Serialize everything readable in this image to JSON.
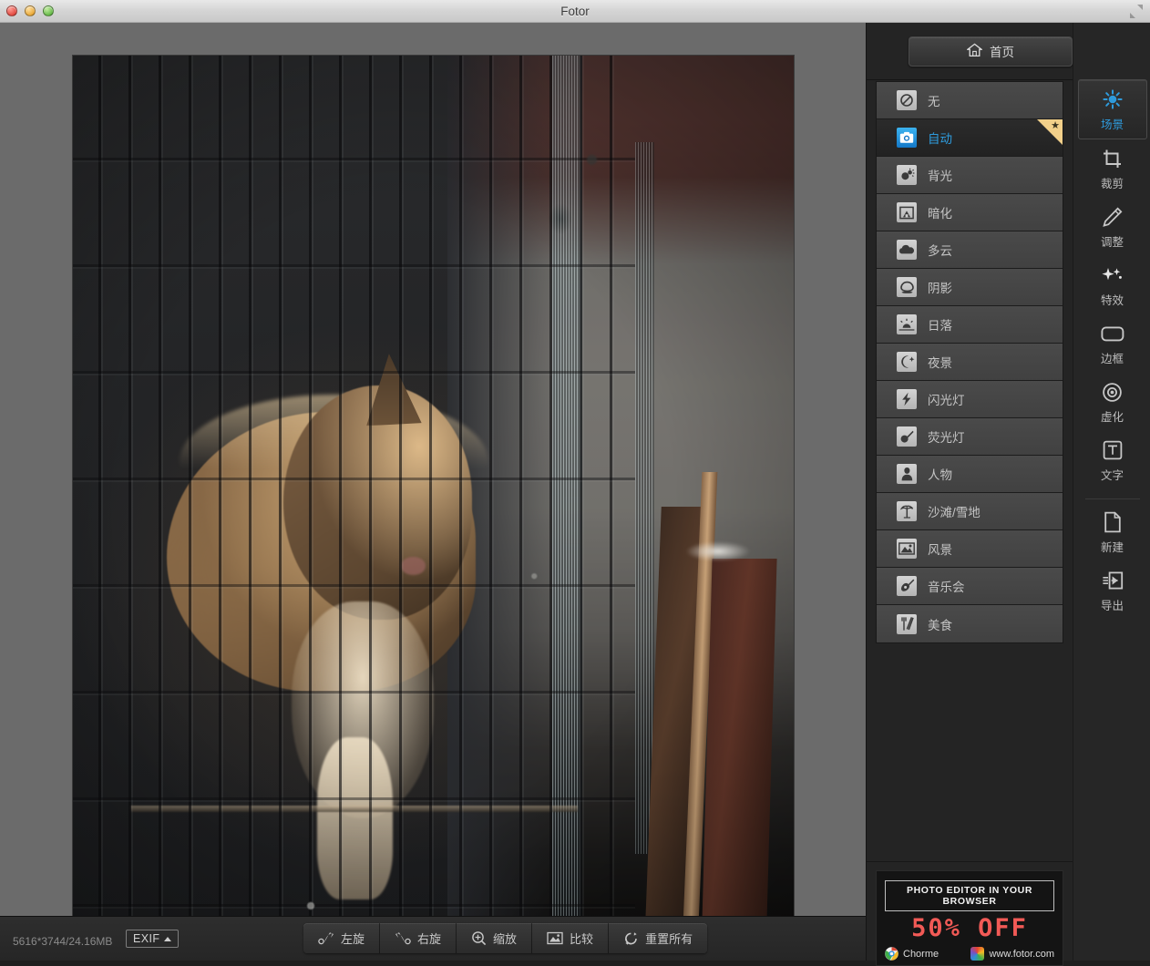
{
  "window": {
    "title": "Fotor",
    "traffic_lights": [
      "close-red",
      "minimize-amber",
      "maximize-green"
    ],
    "fullscreen_icon": "fullscreen-icon"
  },
  "canvas": {
    "photo_alt": "ginger tabby cat sitting behind dark metal cage bars, wooden planks at right"
  },
  "status": {
    "image_info": "5616*3744/24.16MB",
    "exif_label": "EXIF",
    "exif_caret": "caret-up-icon"
  },
  "bottom_toolbar": {
    "buttons": [
      {
        "label": "左旋",
        "icon": "rotate-left-icon"
      },
      {
        "label": "右旋",
        "icon": "rotate-right-icon"
      },
      {
        "label": "缩放",
        "icon": "zoom-in-icon"
      },
      {
        "label": "比较",
        "icon": "compare-image-icon"
      },
      {
        "label": "重置所有",
        "icon": "reset-icon"
      }
    ]
  },
  "right_panel": {
    "home_button": {
      "label": "首页",
      "icon": "home-icon"
    },
    "scenes": [
      {
        "label": "无",
        "icon": "none-forbidden-icon",
        "selected": false,
        "premium": false
      },
      {
        "label": "自动",
        "icon": "camera-auto-icon",
        "selected": true,
        "premium": true
      },
      {
        "label": "背光",
        "icon": "backlight-icon",
        "selected": false,
        "premium": false
      },
      {
        "label": "暗化",
        "icon": "darken-icon",
        "selected": false,
        "premium": false
      },
      {
        "label": "多云",
        "icon": "cloudy-icon",
        "selected": false,
        "premium": false
      },
      {
        "label": "阴影",
        "icon": "shadow-icon",
        "selected": false,
        "premium": false
      },
      {
        "label": "日落",
        "icon": "sunset-icon",
        "selected": false,
        "premium": false
      },
      {
        "label": "夜景",
        "icon": "night-moon-icon",
        "selected": false,
        "premium": false
      },
      {
        "label": "闪光灯",
        "icon": "flash-icon",
        "selected": false,
        "premium": false
      },
      {
        "label": "荧光灯",
        "icon": "fluorescent-icon",
        "selected": false,
        "premium": false
      },
      {
        "label": "人物",
        "icon": "portrait-icon",
        "selected": false,
        "premium": false
      },
      {
        "label": "沙滩/雪地",
        "icon": "beach-snow-icon",
        "selected": false,
        "premium": false
      },
      {
        "label": "风景",
        "icon": "landscape-icon",
        "selected": false,
        "premium": false
      },
      {
        "label": "音乐会",
        "icon": "concert-guitar-icon",
        "selected": false,
        "premium": false
      },
      {
        "label": "美食",
        "icon": "food-cutlery-icon",
        "selected": false,
        "premium": false
      }
    ],
    "rail_top": [
      {
        "label": "场景",
        "icon": "scene-sun-icon",
        "active": true
      },
      {
        "label": "裁剪",
        "icon": "crop-icon",
        "active": false
      },
      {
        "label": "调整",
        "icon": "pencil-icon",
        "active": false
      },
      {
        "label": "特效",
        "icon": "sparkle-icon",
        "active": false
      },
      {
        "label": "边框",
        "icon": "frame-icon",
        "active": false
      },
      {
        "label": "虚化",
        "icon": "tilt-shift-icon",
        "active": false
      },
      {
        "label": "文字",
        "icon": "text-icon",
        "active": false
      }
    ],
    "rail_bottom": [
      {
        "label": "新建",
        "icon": "new-file-icon",
        "active": false
      },
      {
        "label": "导出",
        "icon": "export-icon",
        "active": false
      }
    ],
    "ad": {
      "headline": "PHOTO EDITOR IN YOUR BROWSER",
      "offer": "50% OFF",
      "browser_label": "Chorme",
      "browser_icon": "chrome-icon",
      "site_label": "www.fotor.com",
      "site_icon": "fotor-logo-icon"
    }
  },
  "colors": {
    "accent_blue": "#2e9bdc",
    "panel_bg": "#242424",
    "list_item_bg": "#464646",
    "ad_red": "#f25a56",
    "premium_gold": "#f2d08a"
  }
}
